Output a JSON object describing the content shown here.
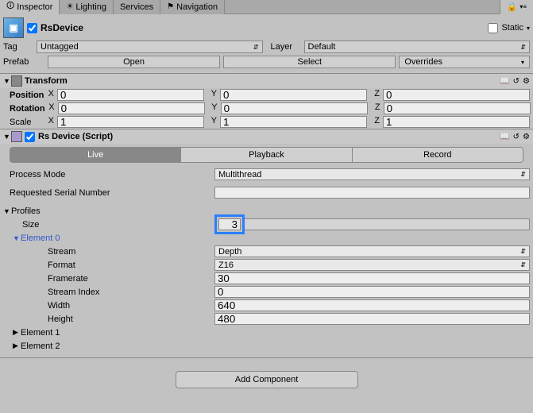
{
  "tabs": {
    "inspector": "Inspector",
    "lighting": "Lighting",
    "services": "Services",
    "navigation": "Navigation"
  },
  "header": {
    "name": "RsDevice",
    "static": "Static",
    "tag_label": "Tag",
    "tag_value": "Untagged",
    "layer_label": "Layer",
    "layer_value": "Default",
    "prefab_label": "Prefab",
    "open": "Open",
    "select": "Select",
    "overrides": "Overrides"
  },
  "transform": {
    "title": "Transform",
    "position": {
      "label": "Position",
      "x": "0",
      "y": "0",
      "z": "0"
    },
    "rotation": {
      "label": "Rotation",
      "x": "0",
      "y": "0",
      "z": "0"
    },
    "scale": {
      "label": "Scale",
      "x": "1",
      "y": "1",
      "z": "1"
    }
  },
  "rsdevice": {
    "title": "Rs Device (Script)",
    "modes": {
      "live": "Live",
      "playback": "Playback",
      "record": "Record"
    },
    "process_mode": {
      "label": "Process Mode",
      "value": "Multithread"
    },
    "serial": {
      "label": "Requested Serial Number",
      "value": ""
    },
    "profiles": {
      "label": "Profiles",
      "size_label": "Size",
      "size": "3"
    },
    "element0": {
      "label": "Element 0",
      "stream": {
        "label": "Stream",
        "value": "Depth"
      },
      "format": {
        "label": "Format",
        "value": "Z16"
      },
      "framerate": {
        "label": "Framerate",
        "value": "30"
      },
      "stream_index": {
        "label": "Stream Index",
        "value": "0"
      },
      "width": {
        "label": "Width",
        "value": "640"
      },
      "height": {
        "label": "Height",
        "value": "480"
      }
    },
    "element1": "Element 1",
    "element2": "Element 2"
  },
  "add_component": "Add Component",
  "axis": {
    "x": "X",
    "y": "Y",
    "z": "Z"
  }
}
